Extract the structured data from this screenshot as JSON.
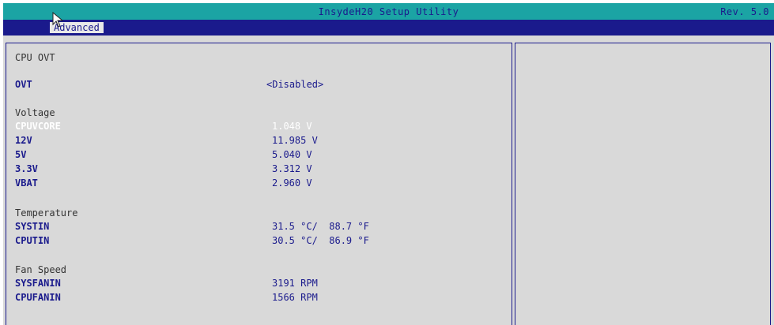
{
  "title_bar": {
    "title": "InsydeH20 Setup Utility",
    "revision": "Rev. 5.0"
  },
  "menu": {
    "active_tab": "Advanced"
  },
  "page": {
    "heading": "CPU OVT",
    "ovt": {
      "label": "OVT",
      "value": "<Disabled>"
    },
    "voltage": {
      "heading": "Voltage",
      "items": [
        {
          "label": "CPUVCORE",
          "value": "1.048 V"
        },
        {
          "label": "12V",
          "value": "11.985 V"
        },
        {
          "label": "5V",
          "value": "5.040 V"
        },
        {
          "label": "3.3V",
          "value": "3.312 V"
        },
        {
          "label": "VBAT",
          "value": "2.960 V"
        }
      ]
    },
    "temperature": {
      "heading": "Temperature",
      "items": [
        {
          "label": "SYSTIN",
          "value": "31.5 °C/  88.7 °F"
        },
        {
          "label": "CPUTIN",
          "value": "30.5 °C/  86.9 °F"
        }
      ]
    },
    "fan_speed": {
      "heading": "Fan Speed",
      "items": [
        {
          "label": "SYSFANIN",
          "value": "3191 RPM"
        },
        {
          "label": "CPUFANIN",
          "value": "1566 RPM"
        }
      ]
    }
  },
  "colors": {
    "title_bar": "#1ba4a4",
    "menu_bar": "#1a1a8c",
    "background": "#d9d9d9",
    "item_text": "#1a1a8c",
    "selected_text": "#ffffff"
  }
}
